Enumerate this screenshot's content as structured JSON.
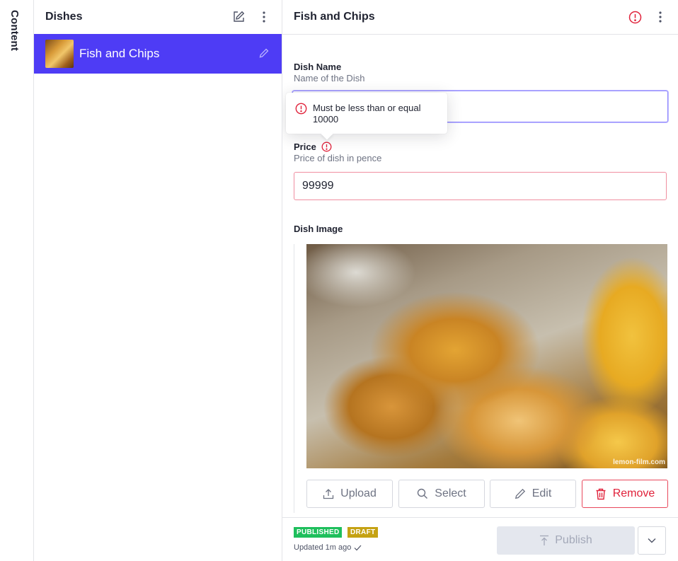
{
  "rail": {
    "label": "Content"
  },
  "list_pane": {
    "title": "Dishes",
    "items": [
      {
        "title": "Fish and Chips"
      }
    ]
  },
  "document": {
    "title": "Fish and Chips",
    "fields": {
      "dish_name": {
        "label": "Dish Name",
        "description": "Name of the Dish"
      },
      "price": {
        "label": "Price",
        "description": "Price of dish in pence",
        "value": "99999"
      },
      "dish_image": {
        "label": "Dish Image",
        "watermark": "lemon-film.com"
      }
    },
    "validation_tooltip": "Must be less than or equal 10000",
    "image_actions": {
      "upload": "Upload",
      "select": "Select",
      "edit": "Edit",
      "remove": "Remove"
    },
    "footer": {
      "badge_published": "PUBLISHED",
      "badge_draft": "DRAFT",
      "updated": "Updated 1m ago",
      "publish": "Publish"
    }
  },
  "colors": {
    "accent": "#4e3cf5",
    "error": "#e0213a",
    "published": "#1ebf5c",
    "draft": "#c5a213"
  }
}
